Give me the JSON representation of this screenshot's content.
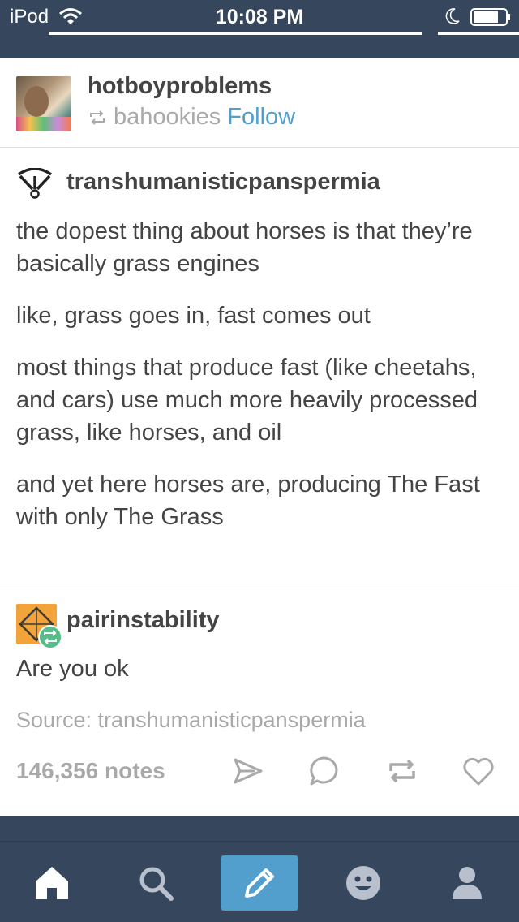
{
  "status_bar": {
    "device": "iPod",
    "time": "10:08 PM"
  },
  "post": {
    "blog_name": "hotboyproblems",
    "reblogged_from": "bahookies",
    "follow_label": "Follow",
    "trail": {
      "username": "transhumanisticpanspermia",
      "paragraphs": [
        "the dopest thing about horses is that they’re basically grass engines",
        "like, grass goes in, fast comes out",
        "most things that produce fast (like cheetahs, and cars) use much more heavily processed grass, like horses, and oil",
        "and yet here horses are, producing The Fast with only The Grass"
      ]
    },
    "reply": {
      "username": "pairinstability",
      "text": "Are you ok"
    },
    "source": "Source: transhumanisticpanspermia",
    "notes": "146,356 notes",
    "actions": [
      "share-icon",
      "reply-icon",
      "reblog-icon",
      "like-icon"
    ]
  },
  "tab_bar": {
    "items": [
      "home-icon",
      "search-icon",
      "compose-icon",
      "activity-icon",
      "account-icon"
    ]
  },
  "colors": {
    "navy": "#36465d",
    "link_blue": "#529ecc",
    "text": "#444444",
    "muted": "#a9a9a9"
  }
}
